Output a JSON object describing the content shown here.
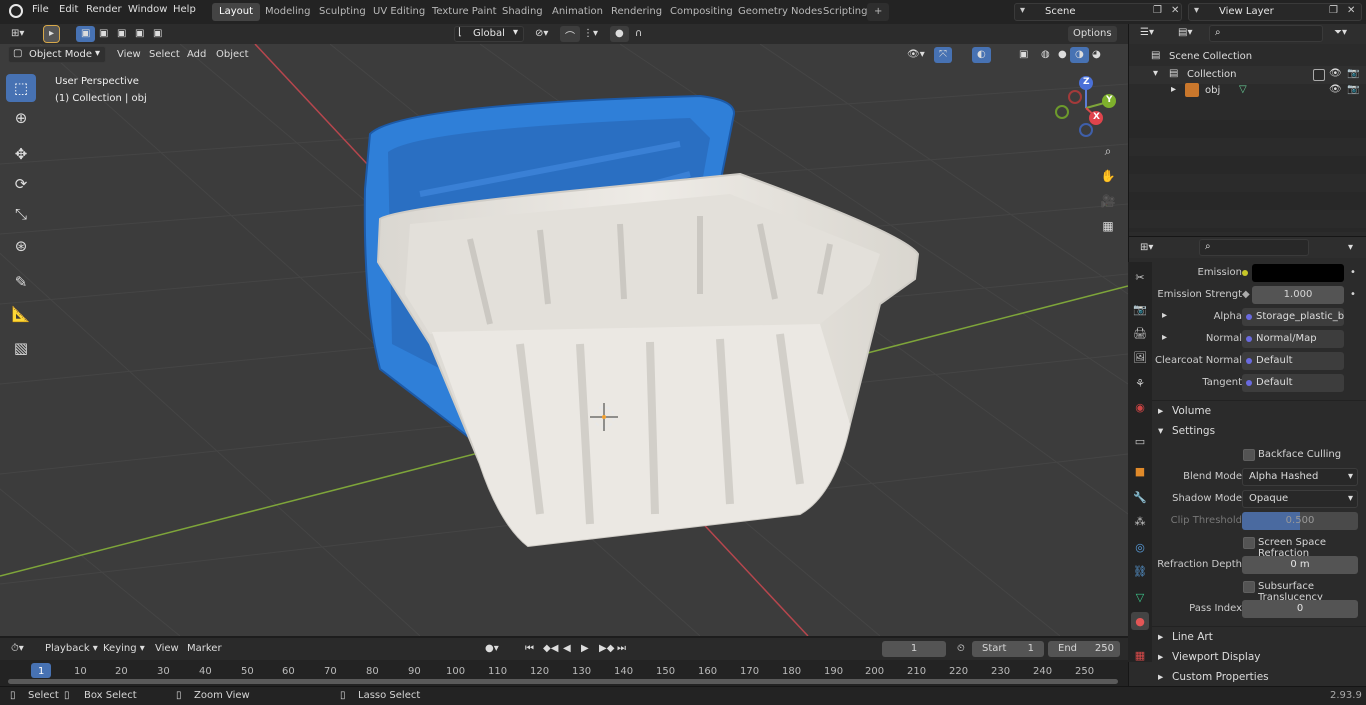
{
  "topbar": {
    "menus": [
      "File",
      "Edit",
      "Render",
      "Window",
      "Help"
    ],
    "workspaces": [
      "Layout",
      "Modeling",
      "Sculpting",
      "UV Editing",
      "Texture Paint",
      "Shading",
      "Animation",
      "Rendering",
      "Compositing",
      "Geometry Nodes",
      "Scripting"
    ],
    "active_workspace": "Layout",
    "add_tab": "+",
    "scene": "Scene",
    "view_layer": "View Layer"
  },
  "viewport_header": {
    "mode": "Object Mode",
    "menus": [
      "View",
      "Select",
      "Add",
      "Object"
    ],
    "orientation": "Global",
    "options": "Options"
  },
  "viewport": {
    "perspective": "User Perspective",
    "collection_info": "(1) Collection | obj",
    "gizmo": {
      "z": "Z",
      "y": "Y",
      "x": "X"
    },
    "colors": {
      "background": "#3b3b3b",
      "grid": "#454545",
      "x_axis": "#b6464d",
      "y_axis": "#7ea53a",
      "lid": "#2f7fd8",
      "bin": "#e7e4de"
    }
  },
  "outliner": {
    "search_placeholder": "",
    "rows": [
      {
        "label": "Scene Collection",
        "indent": 0
      },
      {
        "label": "Collection",
        "indent": 1
      },
      {
        "label": "obj",
        "indent": 2
      }
    ]
  },
  "properties": {
    "rows": [
      {
        "label": "Emission",
        "value": "",
        "kind": "color"
      },
      {
        "label": "Emission Strengt",
        "value": "1.000",
        "kind": "number"
      },
      {
        "label": "Alpha",
        "value": "Storage_plastic_bin_...",
        "kind": "link"
      },
      {
        "label": "Normal",
        "value": "Normal/Map",
        "kind": "link"
      },
      {
        "label": "Clearcoat Normal",
        "value": "Default",
        "kind": "link"
      },
      {
        "label": "Tangent",
        "value": "Default",
        "kind": "link"
      }
    ],
    "sections": {
      "volume": "Volume",
      "settings": "Settings",
      "line_art": "Line Art",
      "viewport_display": "Viewport Display",
      "custom_properties": "Custom Properties"
    },
    "settings": {
      "backface_culling": "Backface Culling",
      "blend_mode_label": "Blend Mode",
      "blend_mode": "Alpha Hashed",
      "shadow_mode_label": "Shadow Mode",
      "shadow_mode": "Opaque",
      "clip_threshold_label": "Clip Threshold",
      "clip_threshold": "0.500",
      "ssr": "Screen Space Refraction",
      "refraction_depth_label": "Refraction Depth",
      "refraction_depth": "0 m",
      "subsurface": "Subsurface Translucency",
      "pass_index_label": "Pass Index",
      "pass_index": "0"
    }
  },
  "timeline": {
    "menus": [
      "Playback",
      "Keying",
      "View",
      "Marker"
    ],
    "current_frame": "1",
    "start_label": "Start",
    "start": "1",
    "end_label": "End",
    "end": "250",
    "ruler": [
      "1",
      "10",
      "20",
      "30",
      "40",
      "50",
      "60",
      "70",
      "80",
      "90",
      "100",
      "110",
      "120",
      "130",
      "140",
      "150",
      "160",
      "170",
      "180",
      "190",
      "200",
      "210",
      "220",
      "230",
      "240",
      "250"
    ]
  },
  "statusbar": {
    "select": "Select",
    "box_select": "Box Select",
    "zoom_view": "Zoom View",
    "lasso_select": "Lasso Select",
    "version": "2.93.9"
  }
}
